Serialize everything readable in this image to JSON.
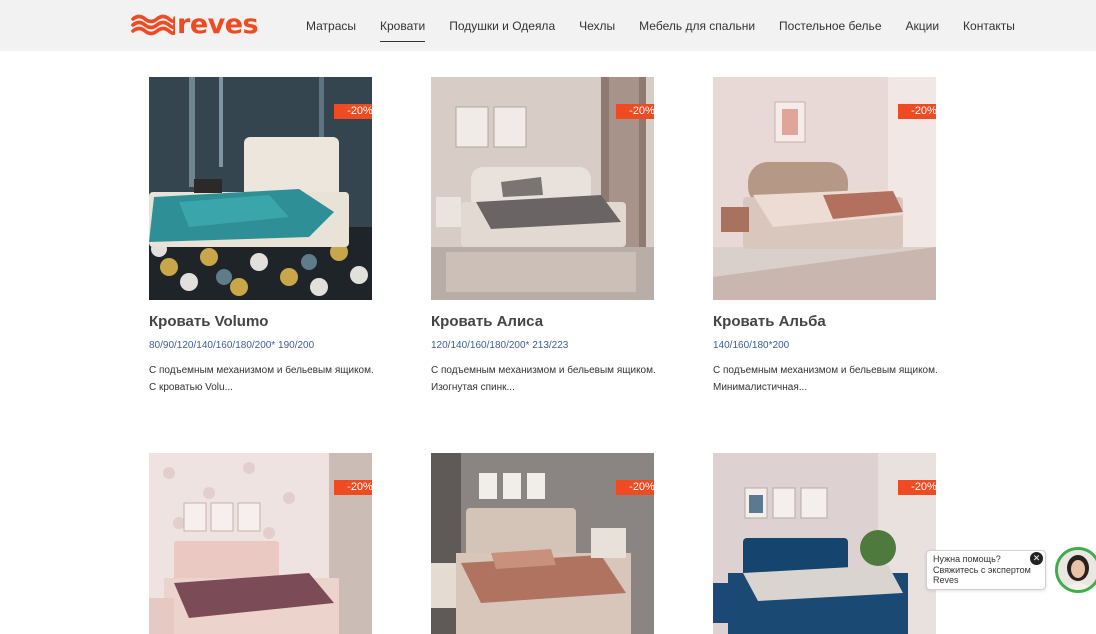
{
  "brand": {
    "name": "reves",
    "accent_color": "#ee4b22",
    "link_color": "#3d5d96"
  },
  "nav": {
    "items": [
      {
        "label": "Матрасы",
        "active": false
      },
      {
        "label": "Кровати",
        "active": true
      },
      {
        "label": "Подушки и Одеяла",
        "active": false
      },
      {
        "label": "Чехлы",
        "active": false
      },
      {
        "label": "Мебель для спальни",
        "active": false
      },
      {
        "label": "Постельное белье",
        "active": false
      },
      {
        "label": "Акции",
        "active": false
      },
      {
        "label": "Контакты",
        "active": false
      }
    ]
  },
  "products": [
    {
      "title": "Кровать Volumo",
      "badge": "-20%",
      "sizes": "80/90/120/140/160/180/200* 190/200",
      "desc_line1": "С подъемным механизмом и бельевым ящиком.",
      "desc_line2": "С кроватью Volu..."
    },
    {
      "title": "Кровать Алиса",
      "badge": "-20%",
      "sizes": "120/140/160/180/200* 213/223",
      "desc_line1": "С подъемным механизмом и бельевым ящиком.",
      "desc_line2": "Изогнутая спинк..."
    },
    {
      "title": "Кровать Альба",
      "badge": "-20%",
      "sizes": "140/160/180*200",
      "desc_line1": "С подъемным механизмом и бельевым ящиком.",
      "desc_line2": "Минималистичная..."
    },
    {
      "badge": "-20%"
    },
    {
      "badge": "-20%"
    },
    {
      "badge": "-20%"
    }
  ],
  "chat": {
    "line1": "Нужна помощь?",
    "line2": "Свяжитесь с экспертом",
    "line3": "Reves",
    "close_glyph": "✕"
  }
}
